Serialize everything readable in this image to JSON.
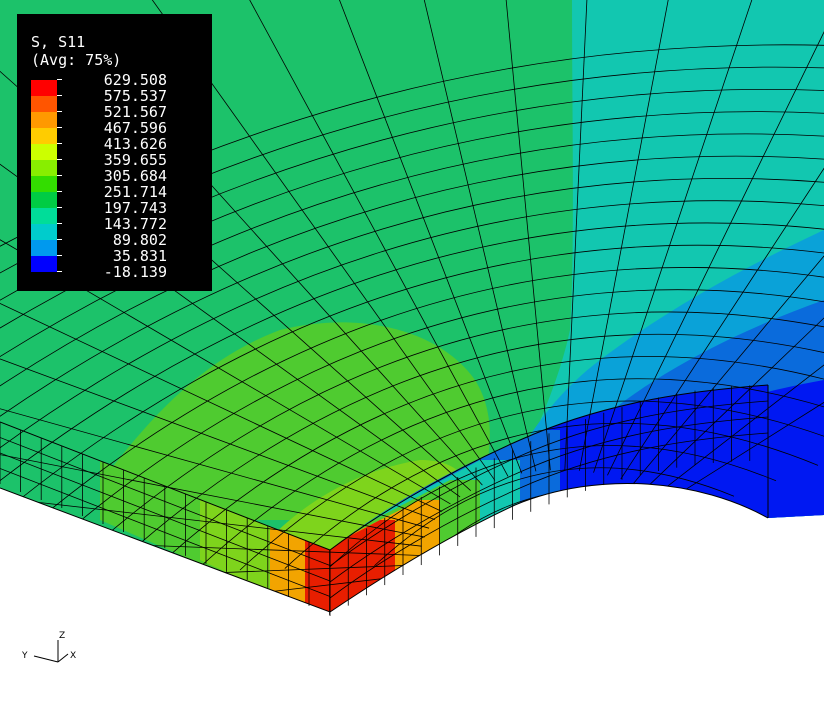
{
  "legend": {
    "title_line1": "S, S11",
    "title_line2": "(Avg: 75%)",
    "entries": [
      {
        "value": "629.508",
        "color": "#ff0000"
      },
      {
        "value": "575.537",
        "color": "#ff5500"
      },
      {
        "value": "521.567",
        "color": "#ff9900"
      },
      {
        "value": "467.596",
        "color": "#ffcc00"
      },
      {
        "value": "413.626",
        "color": "#ccff00"
      },
      {
        "value": "359.655",
        "color": "#88ee00"
      },
      {
        "value": "305.684",
        "color": "#33dd00"
      },
      {
        "value": "251.714",
        "color": "#00cc44"
      },
      {
        "value": "197.743",
        "color": "#00dd99"
      },
      {
        "value": "143.772",
        "color": "#00cccc"
      },
      {
        "value": "89.802",
        "color": "#0099ee"
      },
      {
        "value": "35.831",
        "color": "#0044ff"
      },
      {
        "value": "-18.139",
        "color": ""
      }
    ],
    "bottom_color": "#0000ff"
  },
  "triad": {
    "z": "Z",
    "y": "Y",
    "x": "X"
  },
  "colors": {
    "field_green": "#1cc26a",
    "field_teal": "#12c7b0",
    "field_light_blue": "#0aa2d8",
    "field_mid_blue": "#0a6bdc",
    "field_dark_blue": "#0018f2",
    "hotspot_yellow_green": "#7ed41c",
    "hotspot_orange": "#f2a400",
    "hotspot_red": "#e81e00",
    "mesh_lines": "#000000"
  }
}
